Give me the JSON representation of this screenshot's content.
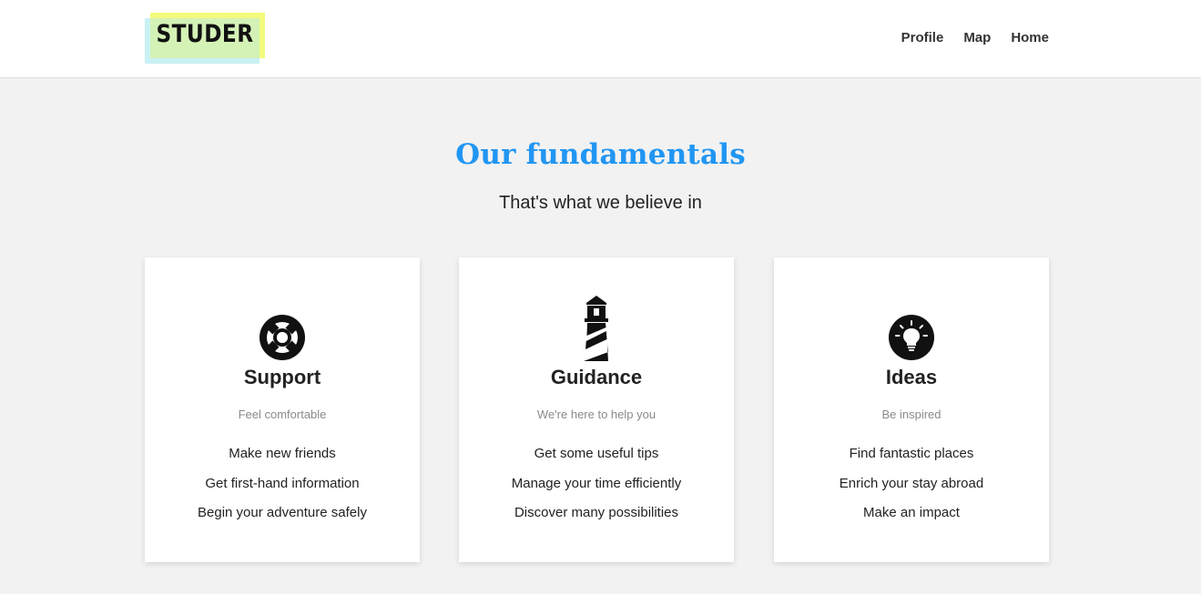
{
  "header": {
    "logo_text": "STUDER",
    "nav": [
      {
        "label": "Profile"
      },
      {
        "label": "Map"
      },
      {
        "label": "Home"
      }
    ]
  },
  "section": {
    "title": "Our fundamentals",
    "subtitle": "That's what we believe in"
  },
  "cards": [
    {
      "icon": "life-ring-icon",
      "title": "Support",
      "tagline": "Feel comfortable",
      "items": [
        "Make new friends",
        "Get first-hand information",
        "Begin your adventure safely"
      ]
    },
    {
      "icon": "lighthouse-icon",
      "title": "Guidance",
      "tagline": "We're here to help you",
      "items": [
        "Get some useful tips",
        "Manage your time efficiently",
        "Discover many possibilities"
      ]
    },
    {
      "icon": "lightbulb-icon",
      "title": "Ideas",
      "tagline": "Be inspired",
      "items": [
        "Find fantastic places",
        "Enrich your stay abroad",
        "Make an impact"
      ]
    }
  ],
  "colors": {
    "accent": "#2196f3",
    "background": "#f2f2f2",
    "logo_yellow": "#f3fa7d",
    "logo_cyan": "#c9f1f4"
  }
}
